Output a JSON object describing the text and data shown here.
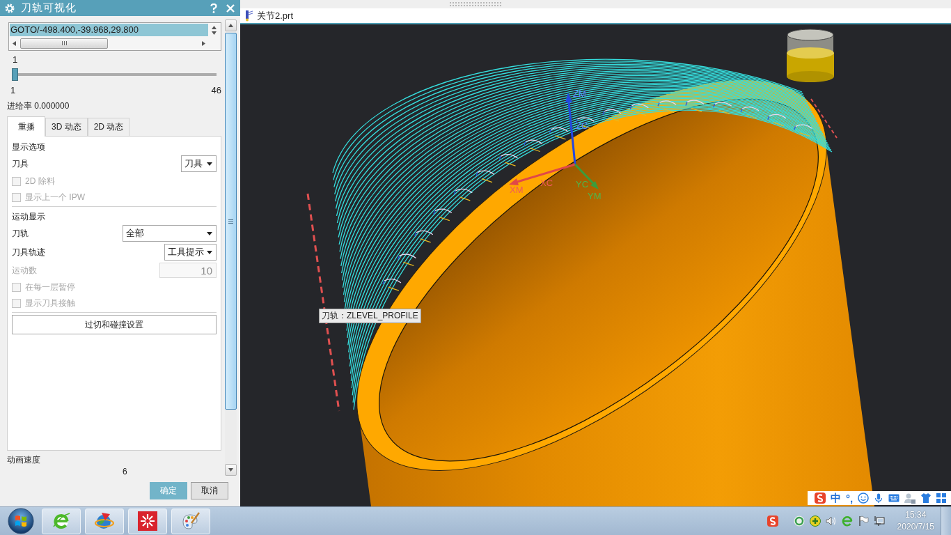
{
  "dialog": {
    "title": "刀轨可视化",
    "listbox": {
      "items": [
        {
          "text": "GOTO/-498.400,-39.968,29.800",
          "selected": true
        }
      ]
    },
    "slider": {
      "value": "1",
      "level": 0,
      "min": "1",
      "max": "46"
    },
    "feed_rate": "进给率 0.000000",
    "tabs": [
      {
        "label": "重播",
        "selected": true
      },
      {
        "label": "3D 动态",
        "selected": false
      },
      {
        "label": "2D 动态",
        "selected": false
      }
    ],
    "panel": {
      "rows": [
        {
          "kind": "heading",
          "text": "显示选项"
        },
        {
          "kind": "dropdown",
          "label": "刀具",
          "value": "刀具"
        },
        {
          "kind": "checkbox",
          "label": "2D 除料",
          "checked": false,
          "disabled": true
        },
        {
          "kind": "checkbox",
          "label": "显示上一个 IPW",
          "checked": false,
          "disabled": true
        },
        {
          "kind": "divider"
        },
        {
          "kind": "heading",
          "text": "运动显示"
        },
        {
          "kind": "dropdown",
          "label": "刀轨",
          "value": "全部"
        },
        {
          "kind": "dropdown",
          "label": "刀具轨迹",
          "value": "工具提示"
        },
        {
          "kind": "number",
          "label": "运动数",
          "value": "10",
          "disabled": true
        },
        {
          "kind": "checkbox",
          "label": "在每一层暂停",
          "checked": false,
          "disabled": true
        },
        {
          "kind": "checkbox",
          "label": "显示刀具接触",
          "checked": false,
          "disabled": true
        },
        {
          "kind": "divider"
        },
        {
          "kind": "button",
          "label": "过切和碰撞设置"
        }
      ]
    },
    "animation_speed": {
      "label": "动画速度",
      "value": "6"
    },
    "buttons": [
      {
        "label": "确定",
        "kind": "primary"
      },
      {
        "label": "取消",
        "kind": "secondary"
      }
    ]
  },
  "viewport": {
    "file_tab": "关节2.prt",
    "axes": [
      {
        "kind": "z",
        "labels": [
          "ZM",
          "ZC"
        ]
      },
      {
        "kind": "x",
        "labels": [
          "XC",
          "XM"
        ]
      },
      {
        "kind": "y",
        "labels": [
          "YC",
          "YM"
        ]
      }
    ],
    "tooltip": "刀轨：ZLEVEL_PROFILE"
  },
  "ime_bar": {
    "mode": "中",
    "punctuation": "°,"
  },
  "taskbar": {
    "time": "15:34",
    "date": "2020/7/15"
  }
}
